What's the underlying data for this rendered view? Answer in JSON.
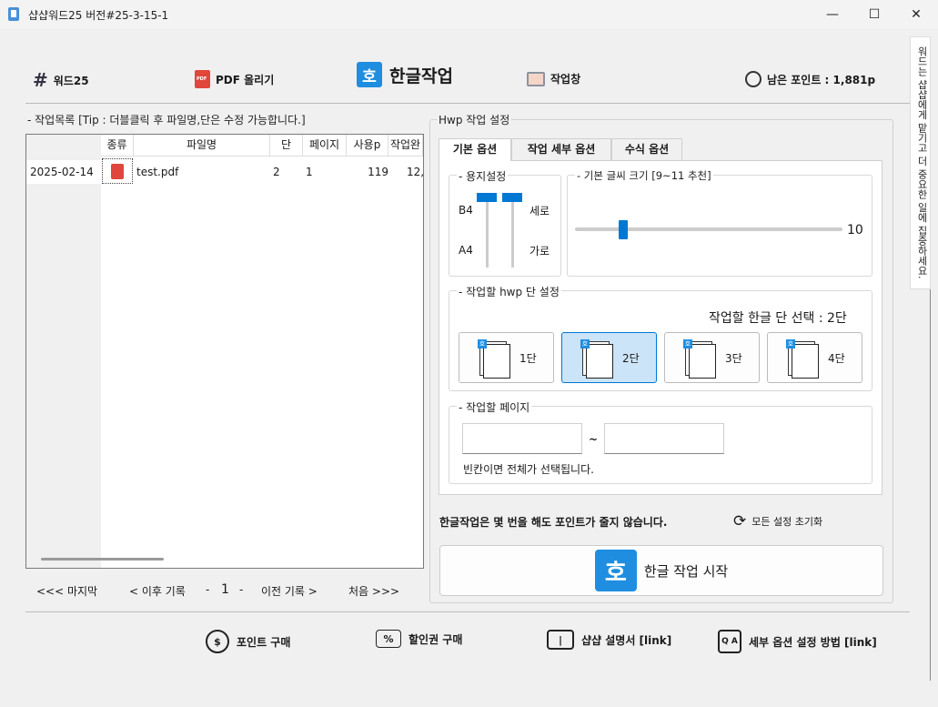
{
  "window": {
    "title": "샵샵워드25  버전#25-3-15-1",
    "minimize_glyph": "—",
    "maximize_glyph": "☐",
    "close_glyph": "✕"
  },
  "topnav": {
    "word_label": "워드25",
    "pdf_upload_label": "PDF 올리기",
    "hangul_icon_char": "호",
    "hangul_title": "한글작업",
    "workwindow_label": "작업창",
    "points_label": "남은 포인트 : 1,881p"
  },
  "joblist": {
    "group_title": "- 작업목록 [Tip : 더블클릭 후 파일명,단은 수정 가능합니다.]",
    "columns": [
      "종류",
      "파일명",
      "단",
      "페이지",
      "사용p",
      "작업완"
    ],
    "rows": [
      {
        "date": "2025-02-14",
        "kind": "pdf-icon",
        "filename": "test.pdf",
        "columns": "2",
        "page": "1",
        "used_points": "119",
        "done": "12,"
      }
    ]
  },
  "pager": {
    "last": "<<< 마지막",
    "next": "< 이후 기록",
    "dash_left": "-",
    "current": "1",
    "dash_right": "-",
    "prev": "이전 기록 >",
    "first": "처음 >>>"
  },
  "hwp": {
    "group_title": "Hwp 작업 설정",
    "tabs": [
      "기본 옵션",
      "작업 세부 옵션",
      "수식 옵션"
    ],
    "paper": {
      "title": "- 용지설정",
      "size_top": "B4",
      "size_bottom": "A4",
      "orient_top": "세로",
      "orient_bottom": "가로"
    },
    "fontsize": {
      "title": "- 기본 글씨 크기 [9~11 추천]",
      "value": "10",
      "slider_fraction": 0.17
    },
    "columns": {
      "title": "- 작업할 hwp 단 설정",
      "selection_text": "작업할 한글 단 선택 : 2단",
      "options": [
        "1단",
        "2단",
        "3단",
        "4단"
      ],
      "selected_index": 1
    },
    "pages": {
      "title": "- 작업할 페이지",
      "tilde": "~",
      "from_value": "",
      "to_value": "",
      "hint": "빈칸이면 전체가 선택됩니다."
    }
  },
  "notice": "한글작업은 몇 번을 해도 포인트가 줄지 않습니다.",
  "reset_label": "모든 설정 초기화",
  "start_button": {
    "icon_char": "호",
    "label": "한글 작업 시작"
  },
  "bottom": {
    "buy_points": "포인트 구매",
    "buy_coupon": "할인권 구매",
    "manual": "샵샵 설명서 [link]",
    "options_help": "세부 옵션 설정 방법 [link]"
  },
  "side_notice": "워드는 샵샵에게 맡기고 더 중요한 일에 집중하세요."
}
